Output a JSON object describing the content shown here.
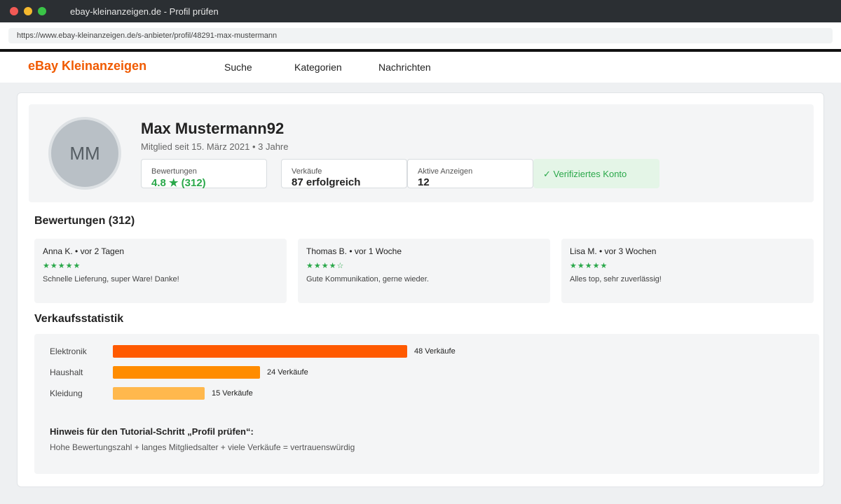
{
  "window": {
    "title": "ebay-kleinanzeigen.de - Profil prüfen"
  },
  "address_bar": {
    "url": "https://www.ebay-kleinanzeigen.de/s-anbieter/profil/48291-max-mustermann"
  },
  "site": {
    "logo": "eBay Kleinanzeigen",
    "nav": [
      "Suche",
      "Kategorien",
      "Nachrichten"
    ]
  },
  "profile": {
    "initials": "MM",
    "name": "Max Mustermann92",
    "member_since": "Mitglied seit 15. März 2021 • 3 Jahre",
    "stats": [
      {
        "label": "Bewertungen",
        "value": "4.8 ★ (312)"
      },
      {
        "label": "Verkäufe",
        "value": "87 erfolgreich"
      },
      {
        "label": "Aktive Anzeigen",
        "value": "12"
      }
    ],
    "verified": "✓ Verifiziertes Konto"
  },
  "reviews": {
    "title": "Bewertungen (312)",
    "items": [
      {
        "author": "Anna K. • vor 2 Tagen",
        "stars": "★★★★★",
        "rating": 5,
        "text": "Schnelle Lieferung, super Ware! Danke!"
      },
      {
        "author": "Thomas B. • vor 1 Woche",
        "stars": "★★★★☆",
        "rating": 4,
        "text": "Gute Kommunikation, gerne wieder."
      },
      {
        "author": "Lisa M. • vor 3 Wochen",
        "stars": "★★★★★",
        "rating": 5,
        "text": "Alles top, sehr zuverlässig!"
      }
    ]
  },
  "sales": {
    "title": "Verkaufsstatistik",
    "rows": [
      {
        "category": "Elektronik",
        "count": 48,
        "label": "48 Verkäufe",
        "color": "#ff5a00"
      },
      {
        "category": "Haushalt",
        "count": 24,
        "label": "24 Verkäufe",
        "color": "#ff8c00"
      },
      {
        "category": "Kleidung",
        "count": 15,
        "label": "15 Verkäufe",
        "color": "#ffb84d"
      }
    ],
    "hint_title": "Hinweis für den Tutorial-Schritt „Profil prüfen“:",
    "hint_text": "Hohe Bewertungszahl + langes Mitgliedsalter + viele Verkäufe = vertrauenswürdig"
  },
  "colors": {
    "brand": "#f05a00",
    "positive": "#2aa84a"
  }
}
